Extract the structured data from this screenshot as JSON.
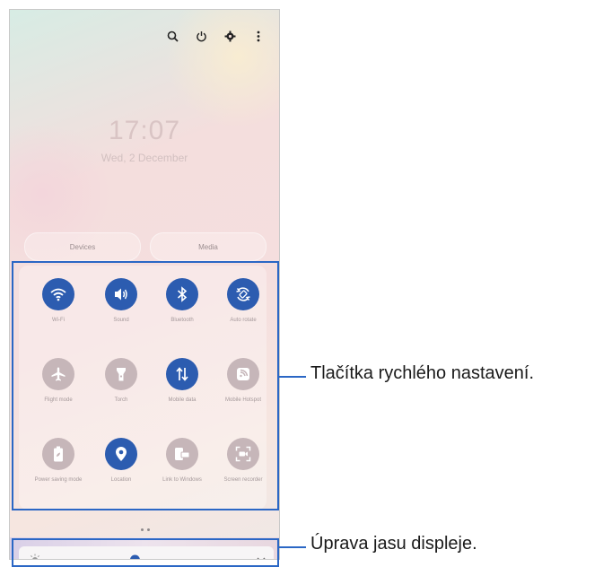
{
  "status": {
    "clock": "17:07",
    "date": "Wed, 2 December"
  },
  "top_icons": [
    "search-icon",
    "power-icon",
    "settings-icon",
    "more-icon"
  ],
  "shortcuts": [
    "Devices",
    "Media"
  ],
  "quick_tiles": [
    {
      "label": "Wi-Fi",
      "icon": "wifi-icon",
      "active": true
    },
    {
      "label": "Sound",
      "icon": "sound-icon",
      "active": true
    },
    {
      "label": "Bluetooth",
      "icon": "bluetooth-icon",
      "active": true
    },
    {
      "label": "Auto rotate",
      "icon": "auto-rotate-icon",
      "active": true
    },
    {
      "label": "Flight mode",
      "icon": "airplane-icon",
      "active": false
    },
    {
      "label": "Torch",
      "icon": "torch-icon",
      "active": false
    },
    {
      "label": "Mobile data",
      "icon": "mobile-data-icon",
      "active": true
    },
    {
      "label": "Mobile Hotspot",
      "icon": "hotspot-icon",
      "active": false
    },
    {
      "label": "Power saving mode",
      "icon": "battery-icon",
      "active": false
    },
    {
      "label": "Location",
      "icon": "location-icon",
      "active": true
    },
    {
      "label": "Link to Windows",
      "icon": "link-windows-icon",
      "active": false
    },
    {
      "label": "Screen recorder",
      "icon": "screen-recorder-icon",
      "active": false
    }
  ],
  "brightness": {
    "level": 0.43
  },
  "callouts": {
    "quick_settings": "Tlačítka rychlého nastavení.",
    "brightness": "Úprava jasu displeje."
  },
  "colors": {
    "active_tile": "#2c5cb0",
    "inactive_tile": "#c6b6b9",
    "callout_line": "#2b67c5"
  }
}
